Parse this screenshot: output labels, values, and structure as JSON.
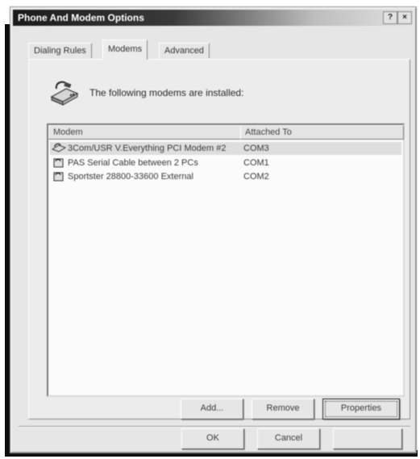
{
  "window": {
    "title": "Phone And Modem Options",
    "help_button": "?",
    "close_button": "×"
  },
  "tabs": [
    {
      "label": "Dialing Rules",
      "active": false
    },
    {
      "label": "Modems",
      "active": true
    },
    {
      "label": "Advanced",
      "active": false
    }
  ],
  "intro": {
    "icon": "modem-icon",
    "text": "The following modems are installed:"
  },
  "modem_list": {
    "columns": [
      "Modem",
      "Attached To"
    ],
    "rows": [
      {
        "name": "3Com/USR V.Everything PCI Modem #2",
        "port": "COM3",
        "icon": "modem-icon",
        "selected": true
      },
      {
        "name": "PAS Serial Cable between 2 PCs",
        "port": "COM1",
        "icon": "modem-icon",
        "selected": false
      },
      {
        "name": "Sportster 28800-33600 External",
        "port": "COM2",
        "icon": "modem-icon",
        "selected": false
      }
    ]
  },
  "buttons": {
    "add": "Add...",
    "remove": "Remove",
    "properties": "Properties",
    "ok": "OK",
    "cancel": "Cancel",
    "apply": ""
  }
}
